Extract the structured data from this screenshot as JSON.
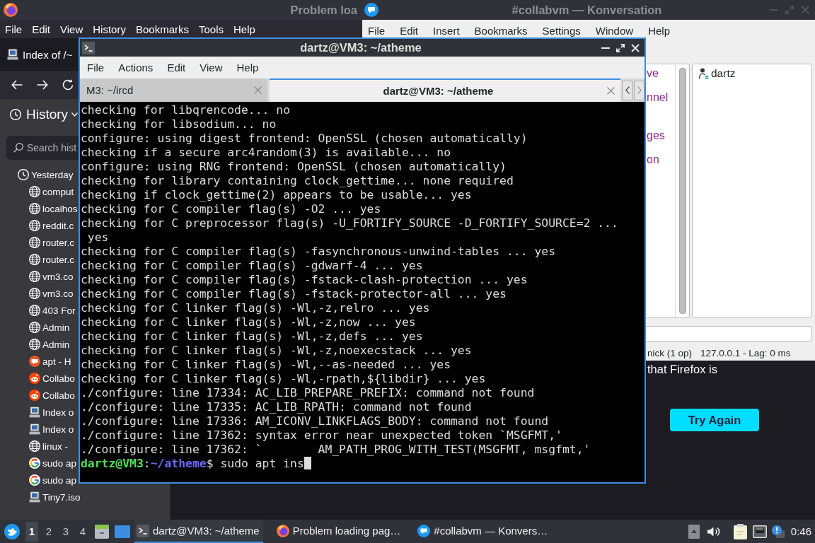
{
  "browser": {
    "title": "Problem loa",
    "menu": [
      "File",
      "Edit",
      "View",
      "History",
      "Bookmarks",
      "Tools",
      "Help"
    ],
    "tabs": [
      {
        "label": "Index of /~"
      }
    ],
    "sidebar": {
      "title": "History",
      "search": {
        "placeholder": "Search hist"
      },
      "groups": [
        {
          "label": "Yesterday",
          "children": [
            {
              "label": "comput",
              "kind": "globe"
            },
            {
              "label": "localhos",
              "kind": "globe"
            },
            {
              "label": "reddit.c",
              "kind": "globe"
            },
            {
              "label": "router.c",
              "kind": "globe"
            },
            {
              "label": "router.c",
              "kind": "globe"
            },
            {
              "label": "vm3.co",
              "kind": "globe"
            },
            {
              "label": "vm3.co",
              "kind": "globe"
            },
            {
              "label": "403 For",
              "kind": "globe"
            },
            {
              "label": "Admin",
              "kind": "globe"
            },
            {
              "label": "Admin",
              "kind": "globe"
            },
            {
              "label": "apt - H",
              "kind": "qa"
            },
            {
              "label": "Collabo",
              "kind": "alien"
            },
            {
              "label": "Collabo",
              "kind": "alien"
            },
            {
              "label": "Index o",
              "kind": "computer"
            },
            {
              "label": "Index o",
              "kind": "computer"
            },
            {
              "label": "linux -",
              "kind": "globe"
            },
            {
              "label": "sudo ap",
              "kind": "ring"
            },
            {
              "label": "sudo ap",
              "kind": "ring"
            },
            {
              "label": "Tiny7.iso",
              "kind": "computer"
            }
          ]
        }
      ]
    },
    "page": {
      "text": "that Firefox is",
      "button": "Try Again"
    }
  },
  "konversation": {
    "title": "#collabvm — Konversation",
    "menu": [
      "File",
      "Edit",
      "Insert",
      "Bookmarks",
      "Settings",
      "Window",
      "Help"
    ],
    "chat_lines": [
      "ve",
      "nnel",
      "ges",
      "on"
    ],
    "nicks": [
      {
        "name": "dartz"
      }
    ],
    "status": [
      "nick (1 op)",
      "127.0.0.1 - Lag: 0 ms"
    ]
  },
  "terminal": {
    "title": "dartz@VM3: ~/atheme",
    "menu": [
      "File",
      "Actions",
      "Edit",
      "View",
      "Help"
    ],
    "tabs": [
      {
        "label": "M3: ~/ircd",
        "selected": false
      },
      {
        "label": "dartz@VM3: ~/atheme",
        "selected": true
      }
    ],
    "lines": [
      "checking for libqrencode... no",
      "checking for libsodium... no",
      "configure: using digest frontend: OpenSSL (chosen automatically)",
      "checking if a secure arc4random(3) is available... no",
      "configure: using RNG frontend: OpenSSL (chosen automatically)",
      "checking for library containing clock_gettime... none required",
      "checking if clock_gettime(2) appears to be usable... yes",
      "checking for C compiler flag(s) -O2 ... yes",
      "checking for C preprocessor flag(s) -U_FORTIFY_SOURCE -D_FORTIFY_SOURCE=2 ...",
      " yes",
      "checking for C compiler flag(s) -fasynchronous-unwind-tables ... yes",
      "checking for C compiler flag(s) -gdwarf-4 ... yes",
      "checking for C compiler flag(s) -fstack-clash-protection ... yes",
      "checking for C compiler flag(s) -fstack-protector-all ... yes",
      "checking for C linker flag(s) -Wl,-z,relro ... yes",
      "checking for C linker flag(s) -Wl,-z,now ... yes",
      "checking for C linker flag(s) -Wl,-z,defs ... yes",
      "checking for C linker flag(s) -Wl,-z,noexecstack ... yes",
      "checking for C linker flag(s) -Wl,--as-needed ... yes",
      "checking for C linker flag(s) -Wl,-rpath,${libdir} ... yes",
      "./configure: line 17334: AC_LIB_PREPARE_PREFIX: command not found",
      "./configure: line 17335: AC_LIB_RPATH: command not found",
      "./configure: line 17336: AM_ICONV_LINKFLAGS_BODY: command not found",
      "./configure: line 17362: syntax error near unexpected token `MSGFMT,'",
      "./configure: line 17362: `        AM_PATH_PROG_WITH_TEST(MSGFMT, msgfmt,'"
    ],
    "prompt": {
      "user_host": "dartz@VM3",
      "separator": ":",
      "path": "~/atheme",
      "symbol": "$",
      "command": "sudo apt ins"
    }
  },
  "taskbar": {
    "workspaces": [
      {
        "label": "1",
        "selected": true
      },
      {
        "label": "2",
        "selected": false
      },
      {
        "label": "3",
        "selected": false
      },
      {
        "label": "4",
        "selected": false
      }
    ],
    "tasks": [
      {
        "label": "dartz@VM3: ~/atheme",
        "kind": "terminal",
        "selected": true
      },
      {
        "label": "Problem loading pag…",
        "kind": "browser",
        "selected": false
      },
      {
        "label": "#collabvm — Konvers…",
        "kind": "chat",
        "selected": false
      }
    ],
    "clock": "0:46"
  }
}
